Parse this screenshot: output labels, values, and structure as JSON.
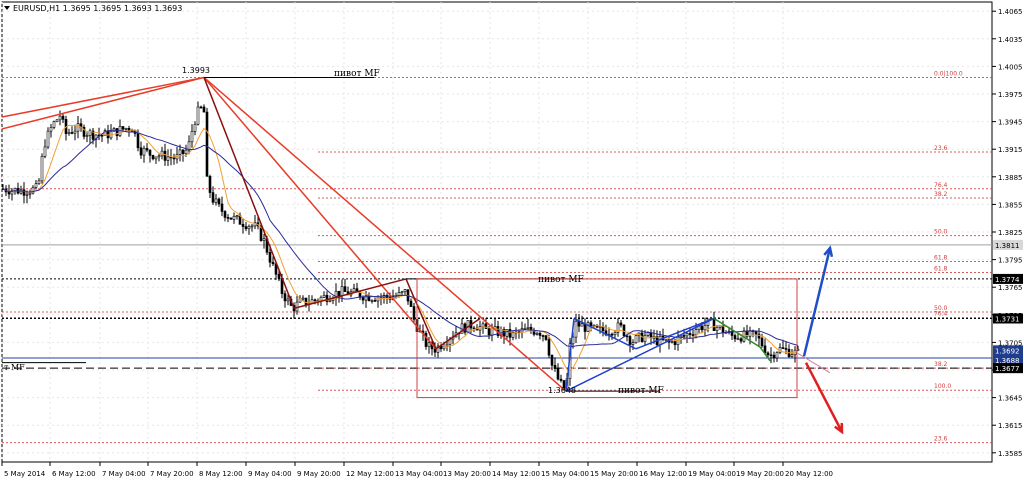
{
  "chart_data": {
    "type": "candlestick",
    "header": {
      "symbol_info": "EURUSD,H1  1.3695 1.3695 1.3693 1.3693"
    },
    "y_range": [
      1.3575,
      1.4075
    ],
    "y_ticks": [
      {
        "value": 1.4065,
        "label": "1.4065"
      },
      {
        "value": 1.4035,
        "label": "1.4035"
      },
      {
        "value": 1.4005,
        "label": "1.4005"
      },
      {
        "value": 1.3975,
        "label": "1.3975"
      },
      {
        "value": 1.3945,
        "label": "1.3945"
      },
      {
        "value": 1.3915,
        "label": "1.3915"
      },
      {
        "value": 1.3885,
        "label": "1.3885"
      },
      {
        "value": 1.3855,
        "label": "1.3855"
      },
      {
        "value": 1.3825,
        "label": "1.3825"
      },
      {
        "value": 1.3795,
        "label": "1.3795"
      },
      {
        "value": 1.3765,
        "label": "1.3765"
      },
      {
        "value": 1.3735,
        "label": "1.3735"
      },
      {
        "value": 1.3705,
        "label": "1.3705"
      },
      {
        "value": 1.3675,
        "label": "1.3675"
      },
      {
        "value": 1.3645,
        "label": "1.3645"
      },
      {
        "value": 1.3615,
        "label": "1.3615"
      },
      {
        "value": 1.3585,
        "label": "1.3585"
      }
    ],
    "x_ticks": [
      "5 May 2014",
      "6 May 12:00",
      "7 May 04:00",
      "7 May 20:00",
      "8 May 12:00",
      "9 May 04:00",
      "9 May 20:00",
      "12 May 12:00",
      "13 May 04:00",
      "13 May 20:00",
      "14 May 12:00",
      "15 May 04:00",
      "15 May 20:00",
      "16 May 12:00",
      "19 May 04:00",
      "19 May 20:00",
      "20 May 12:00"
    ],
    "price_tags": [
      {
        "value": 1.3811,
        "label": "1.3811",
        "bg": "#d8d8d8",
        "fg": "#000000"
      },
      {
        "value": 1.3774,
        "label": "1.3774",
        "bg": "#000000",
        "fg": "#ffffff"
      },
      {
        "value": 1.3731,
        "label": "1.3731",
        "bg": "#000000",
        "fg": "#ffffff"
      },
      {
        "value": 1.3692,
        "label": "1.3692",
        "bg": "#1f3d8c",
        "fg": "#ffffff"
      },
      {
        "value": 1.3688,
        "label": "1.3688",
        "bg": "#1f3d8c",
        "fg": "#ffffff"
      },
      {
        "value": 1.3677,
        "label": "1.3677",
        "bg": "#000000",
        "fg": "#ffffff"
      }
    ],
    "price_labels": [
      {
        "label": "1.3993",
        "value": 1.3993
      },
      {
        "label": "1.3648",
        "value": 1.3648
      }
    ],
    "pivot_labels": [
      "пивот MF",
      "пивот MF",
      "пивот MF",
      "т MF"
    ],
    "fib_levels": [
      {
        "label": "0.0|100.0",
        "value": 1.3993
      },
      {
        "label": "23.6",
        "value": 1.3912
      },
      {
        "label": "76.4",
        "value": 1.3872
      },
      {
        "label": "38.2",
        "value": 1.3862
      },
      {
        "label": "50.0",
        "value": 1.3821
      },
      {
        "label": "61.8",
        "value": 1.3793
      },
      {
        "label": "61.8",
        "value": 1.3781
      },
      {
        "label": "50.0",
        "value": 1.3738
      },
      {
        "label": "76.4",
        "value": 1.3732
      },
      {
        "label": "38.2",
        "value": 1.3677
      },
      {
        "label": "100.0",
        "value": 1.3653
      },
      {
        "label": "23.6",
        "value": 1.3596
      }
    ],
    "grid": true,
    "colors": {
      "bull_candle": "#000000",
      "bear_candle": "#000000",
      "ma_fast": "#f0a030",
      "ma_slow": "#2a2a9a",
      "fib_lines": "#d04040",
      "trend_red": "#e83c28",
      "trend_darkred": "#8a1010",
      "trend_blue": "#2040d0",
      "trend_green": "#2a8a2a",
      "arrow_up": "#1f4fc8",
      "arrow_down": "#e02020",
      "box": "#d04040"
    }
  }
}
